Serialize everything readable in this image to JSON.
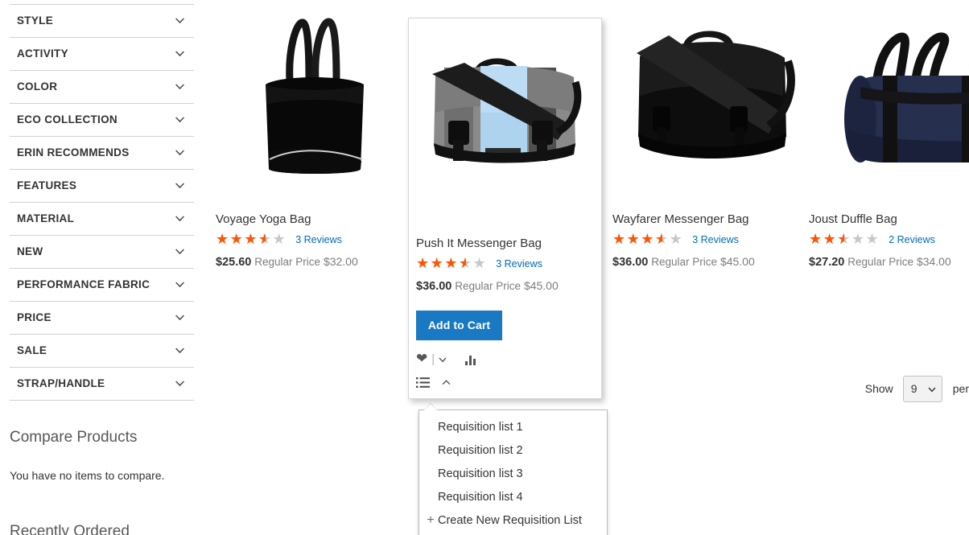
{
  "sidebar": {
    "filters": [
      {
        "label": "STYLE"
      },
      {
        "label": "ACTIVITY"
      },
      {
        "label": "COLOR"
      },
      {
        "label": "ECO COLLECTION"
      },
      {
        "label": "ERIN RECOMMENDS"
      },
      {
        "label": "FEATURES"
      },
      {
        "label": "MATERIAL"
      },
      {
        "label": "NEW"
      },
      {
        "label": "PERFORMANCE FABRIC"
      },
      {
        "label": "PRICE"
      },
      {
        "label": "SALE"
      },
      {
        "label": "STRAP/HANDLE"
      }
    ],
    "compare": {
      "title": "Compare Products",
      "empty_text": "You have no items to compare."
    },
    "recently_ordered_title": "Recently Ordered"
  },
  "products": [
    {
      "name": "Voyage Yoga Bag",
      "rating_percent": 70,
      "reviews_label": "3 Reviews",
      "special_price": "$25.60",
      "regular_price_label": "Regular Price",
      "regular_price": "$32.00",
      "image": "black-tote-bag"
    },
    {
      "name": "Push It Messenger Bag",
      "rating_percent": 70,
      "reviews_label": "3 Reviews",
      "special_price": "$36.00",
      "regular_price_label": "Regular Price",
      "regular_price": "$45.00",
      "image": "gray-blue-messenger-bag",
      "add_to_cart_label": "Add to Cart",
      "hovered": true
    },
    {
      "name": "Wayfarer Messenger Bag",
      "rating_percent": 70,
      "reviews_label": "3 Reviews",
      "special_price": "$36.00",
      "regular_price_label": "Regular Price",
      "regular_price": "$45.00",
      "image": "black-messenger-bag"
    },
    {
      "name": "Joust Duffle Bag",
      "rating_percent": 50,
      "reviews_label": "2 Reviews",
      "special_price": "$27.20",
      "regular_price_label": "Regular Price",
      "regular_price": "$34.00",
      "image": "navy-duffle-bag"
    }
  ],
  "requisition_dropdown": {
    "items": [
      "Requisition list 1",
      "Requisition list 2",
      "Requisition list 3",
      "Requisition list 4"
    ],
    "create_label": "Create New Requisition List",
    "create_icon": "plus-icon"
  },
  "toolbar": {
    "show_label": "Show",
    "limiter_value": "9",
    "per_label": "per"
  },
  "colors": {
    "star_full": "#ff5501",
    "star_empty": "#c7c7c7",
    "link": "#006bb4",
    "button": "#1979c3"
  },
  "stars_glyphs": "★★★★★"
}
